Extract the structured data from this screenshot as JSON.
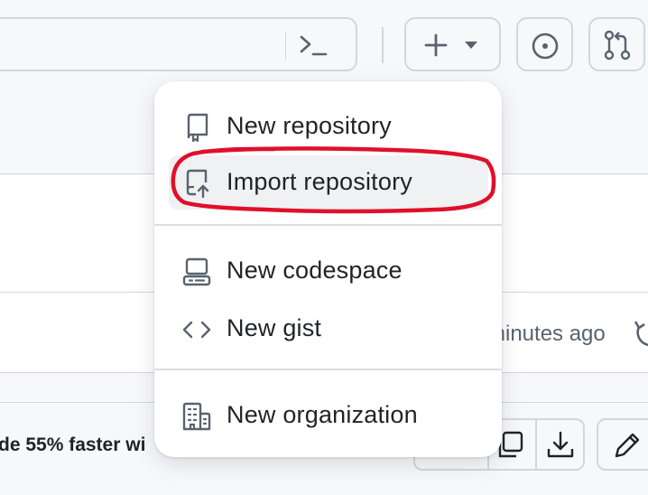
{
  "header": {
    "create_button_icons": [
      "plus-icon",
      "triangle-down-icon"
    ],
    "issues_icon": "issue-opened-icon",
    "pulls_icon": "git-pull-request-icon",
    "command_palette_icon": "terminal-icon"
  },
  "menu": {
    "items": [
      {
        "label": "New repository",
        "icon": "repo-icon"
      },
      {
        "label": "Import repository",
        "icon": "repo-push-icon"
      },
      {
        "label": "New codespace",
        "icon": "codespaces-icon"
      },
      {
        "label": "New gist",
        "icon": "code-icon"
      },
      {
        "label": "New organization",
        "icon": "organization-icon"
      }
    ],
    "highlighted_item": "Import repository"
  },
  "background": {
    "commit_time": "minutes ago",
    "promo_text": "de 55% faster wi"
  },
  "colors": {
    "annotation": "#e0102a",
    "hover_bg": "#eff1f3",
    "border": "#d0d7de",
    "icon": "#59636e"
  }
}
